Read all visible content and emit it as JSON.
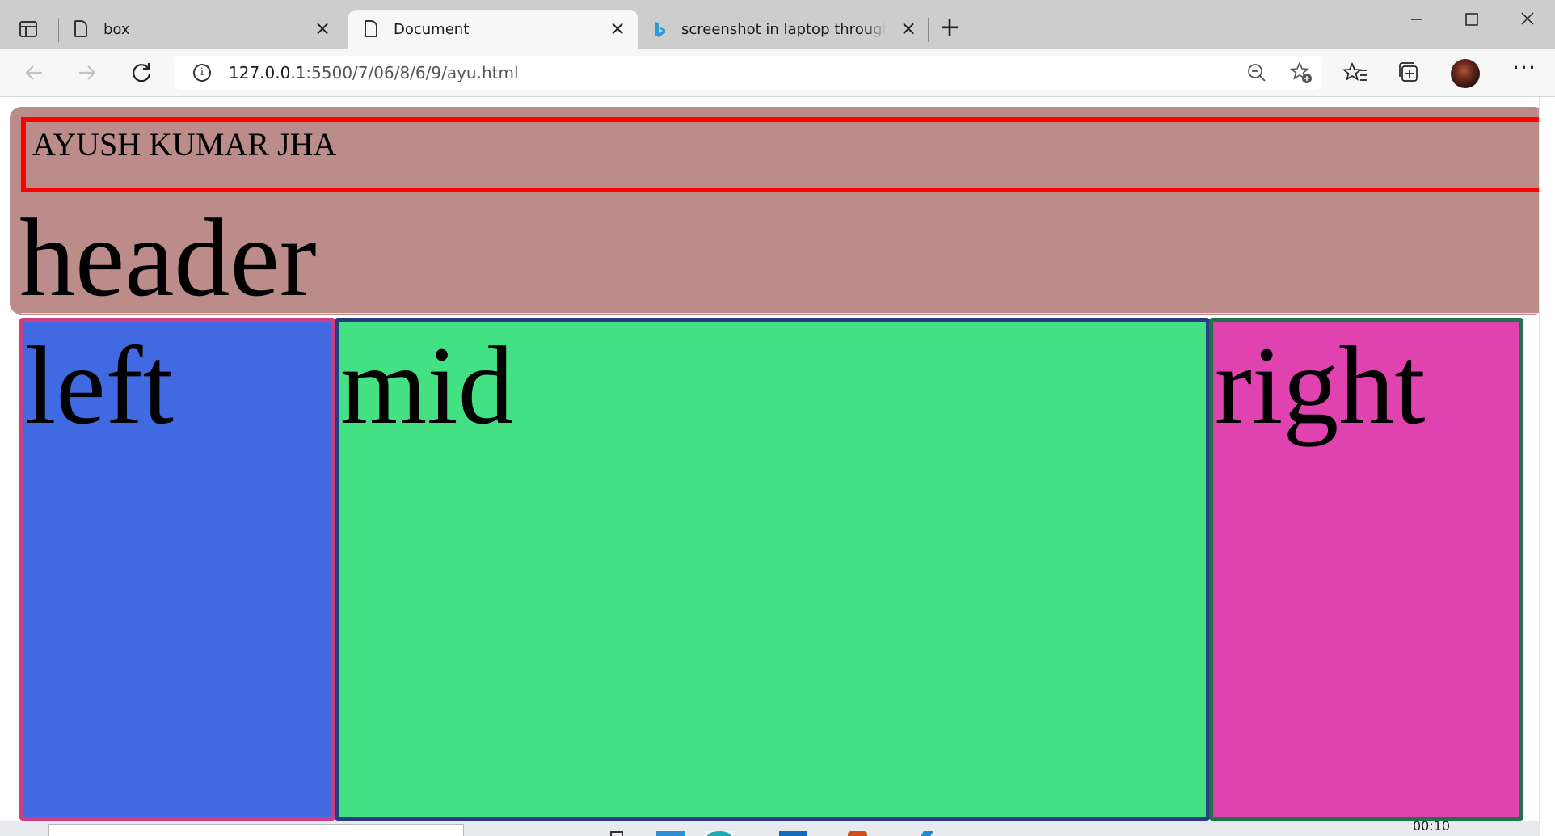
{
  "browser": {
    "tabs": [
      {
        "title": "box",
        "active": false,
        "icon": "page-icon"
      },
      {
        "title": "Document",
        "active": true,
        "icon": "page-icon"
      },
      {
        "title": "screenshot in laptop through key",
        "active": false,
        "icon": "bing-icon"
      }
    ],
    "address": {
      "host": "127.0.0.1",
      "path": ":5500/7/06/8/6/9/ayu.html"
    }
  },
  "page": {
    "name": "AYUSH KUMAR JHA",
    "header": "header",
    "columns": {
      "left": "left",
      "mid": "mid",
      "right": "right"
    }
  },
  "taskbar": {
    "clock": "00:10"
  },
  "colors": {
    "header_bg": "#bc8c8a",
    "name_border": "#ff0000",
    "left_bg": "#4169e1",
    "left_border": "#cc3f86",
    "mid_bg": "#44e184",
    "mid_border": "#283b84",
    "right_bg": "#e043b0",
    "right_border": "#1e7448"
  }
}
